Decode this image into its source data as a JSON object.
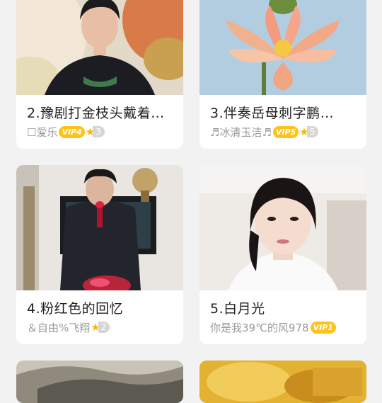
{
  "cards": [
    {
      "title": "2.豫剧打金枝头戴着…",
      "author": "☐爱乐",
      "vip": "VIP4",
      "level": "3"
    },
    {
      "title": "3.伴奏岳母刺字鹏…",
      "author": "♬冰清玉洁♬",
      "vip": "VIP5",
      "level": "5"
    },
    {
      "title": "4.粉红色的回忆",
      "author": "＆自由%飞翔",
      "vip": "",
      "level": "2"
    },
    {
      "title": "5.白月光",
      "author": "你是我39℃的风978",
      "vip": "VIP1",
      "level": ""
    }
  ],
  "icons": {
    "star": "star-icon"
  },
  "colors": {
    "vip_badge": "#ffc21a",
    "star": "#ffb400",
    "level_badge": "#d6d6d6"
  }
}
